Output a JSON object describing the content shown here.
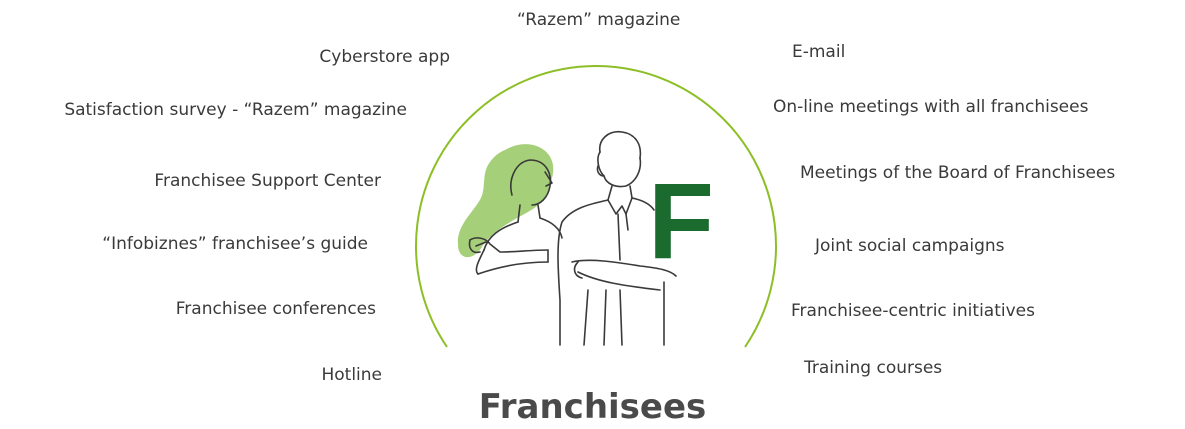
{
  "title": "Franchisees",
  "logo_letter": "F",
  "colors": {
    "arc": "#8cbf26",
    "logo_green": "#1b6b2e",
    "hair_green": "#a6cf7a",
    "line": "#3a3a3a",
    "text": "#3a3a3a"
  },
  "left_items": [
    "Cyberstore app",
    "Satisfaction survey - “Razem” magazine",
    "Franchisee Support Center",
    "“Infobiznes” franchisee’s guide",
    "Franchisee conferences",
    "Hotline"
  ],
  "top_item": "“Razem” magazine",
  "right_items": [
    "E-mail",
    "On-line meetings with all franchisees",
    "Meetings of the Board of Franchisees",
    "Joint social campaigns",
    "Franchisee-centric initiatives",
    "Training courses"
  ]
}
